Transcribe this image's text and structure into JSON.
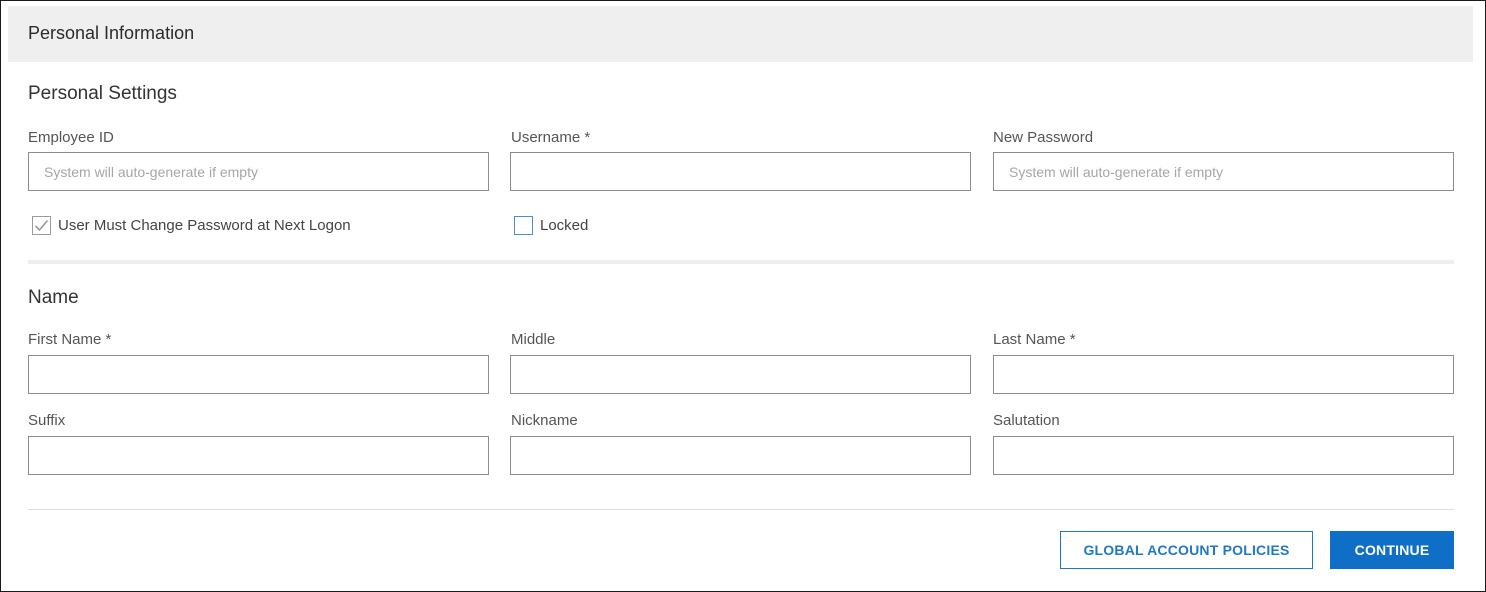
{
  "panel": {
    "title": "Personal Information"
  },
  "personal_settings": {
    "title": "Personal Settings",
    "employee_id": {
      "label": "Employee ID",
      "value": "",
      "placeholder": "System will auto-generate if empty"
    },
    "username": {
      "label": "Username *",
      "value": "",
      "placeholder": ""
    },
    "new_password": {
      "label": "New Password",
      "value": "",
      "placeholder": "System will auto-generate if empty"
    },
    "must_change_password": {
      "label": "User Must Change Password at Next Logon",
      "checked": true
    },
    "locked": {
      "label": "Locked",
      "checked": false
    }
  },
  "name": {
    "title": "Name",
    "first_name": {
      "label": "First Name *",
      "value": ""
    },
    "middle": {
      "label": "Middle",
      "value": ""
    },
    "last_name": {
      "label": "Last Name *",
      "value": ""
    },
    "suffix": {
      "label": "Suffix",
      "value": ""
    },
    "nickname": {
      "label": "Nickname",
      "value": ""
    },
    "salutation": {
      "label": "Salutation",
      "value": ""
    }
  },
  "actions": {
    "global_policies_label": "GLOBAL ACCOUNT POLICIES",
    "continue_label": "CONTINUE"
  },
  "colors": {
    "accent": "#0f6fc6",
    "header_bg": "#efefef",
    "input_border": "#8c8c8c",
    "checkbox_accent": "#4d8fc7"
  },
  "icons": {
    "must_change_password": "checkmark-icon"
  }
}
